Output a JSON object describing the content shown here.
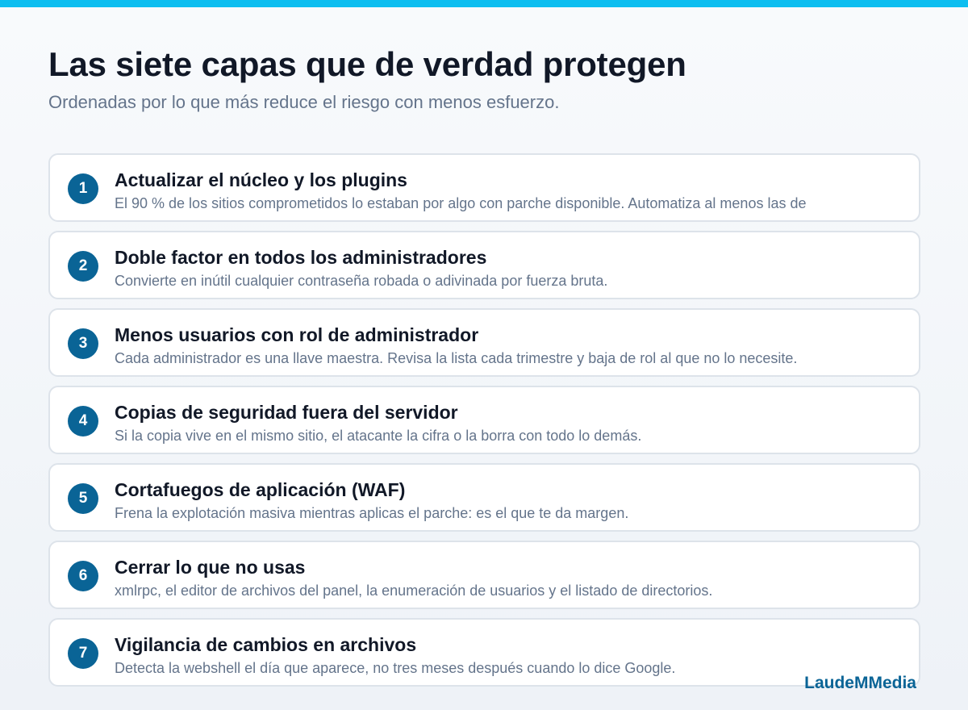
{
  "header": {
    "title": "Las siete capas que de verdad protegen",
    "subtitle": "Ordenadas por lo que más reduce el riesgo con menos esfuerzo."
  },
  "layers": [
    {
      "number": "1",
      "title": "Actualizar el núcleo y los plugins",
      "description": "El 90 % de los sitios comprometidos lo estaban por algo con parche disponible. Automatiza al menos las de"
    },
    {
      "number": "2",
      "title": "Doble factor en todos los administradores",
      "description": "Convierte en inútil cualquier contraseña robada o adivinada por fuerza bruta."
    },
    {
      "number": "3",
      "title": "Menos usuarios con rol de administrador",
      "description": "Cada administrador es una llave maestra. Revisa la lista cada trimestre y baja de rol al que no lo necesite."
    },
    {
      "number": "4",
      "title": "Copias de seguridad fuera del servidor",
      "description": "Si la copia vive en el mismo sitio, el atacante la cifra o la borra con todo lo demás."
    },
    {
      "number": "5",
      "title": "Cortafuegos de aplicación (WAF)",
      "description": "Frena la explotación masiva mientras aplicas el parche: es el que te da margen."
    },
    {
      "number": "6",
      "title": "Cerrar lo que no usas",
      "description": "xmlrpc, el editor de archivos del panel, la enumeración de usuarios y el listado de directorios."
    },
    {
      "number": "7",
      "title": "Vigilancia de cambios en archivos",
      "description": "Detecta la webshell el día que aparece, no tres meses después cuando lo dice Google."
    }
  ],
  "footer": {
    "brand": "LaudeMMedia"
  },
  "colors": {
    "accent_bar": "#0ebef0",
    "badge": "#0a6496",
    "brand": "#0a6496"
  }
}
